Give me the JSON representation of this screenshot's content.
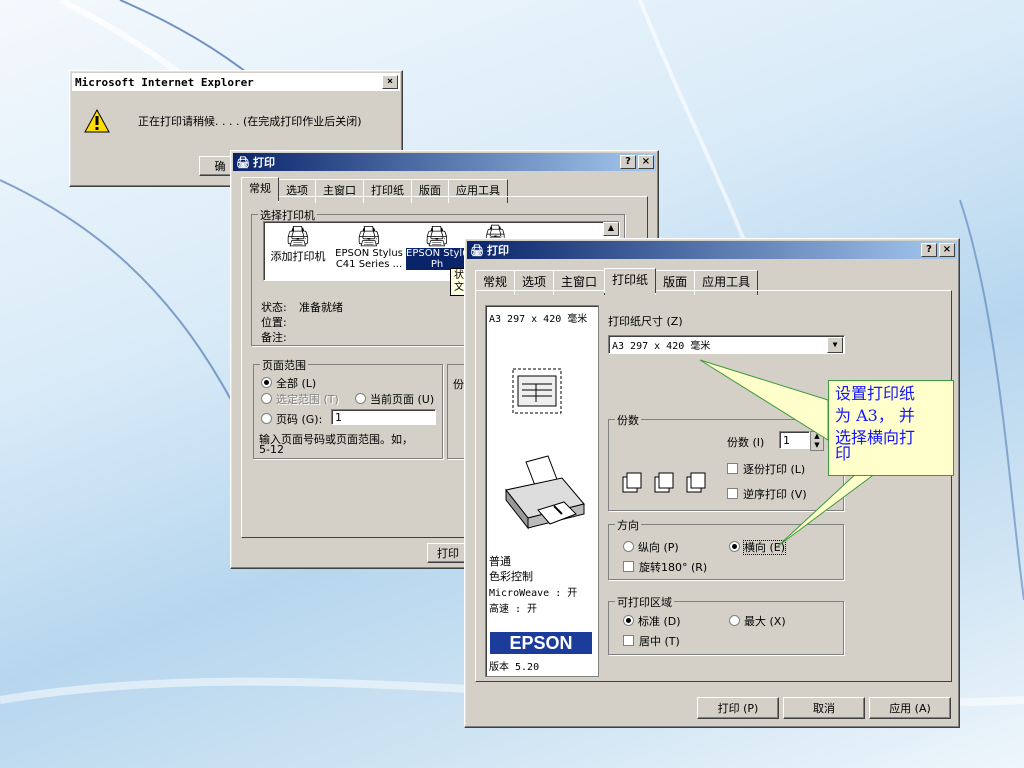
{
  "ie_dialog": {
    "title": "Microsoft Internet Explorer",
    "message": "正在打印请稍候. . . . (在完成打印作业后关闭)",
    "button_partial": "确"
  },
  "back_print": {
    "title": "打印",
    "tabs": [
      "常规",
      "选项",
      "主窗口",
      "打印纸",
      "版面",
      "应用工具"
    ],
    "select_printer_label": "选择打印机",
    "printers": [
      {
        "name1": "添加打印机",
        "name2": ""
      },
      {
        "name1": "EPSON Stylus",
        "name2": "C41 Series ..."
      },
      {
        "name1": "EPSON Stylus",
        "name2": "Ph"
      },
      {
        "name1": "",
        "name2": ""
      }
    ],
    "tooltip_status": "状态: 1",
    "tooltip_doc": "文档: (",
    "status_label": "状态:",
    "status_value": "准备就绪",
    "location_label": "位置:",
    "comment_label": "备注:",
    "page_range_label": "页面范围",
    "all_label": "全部 (L)",
    "selection_label": "选定范围 (T)",
    "current_page_label": "当前页面 (U)",
    "pages_label": "页码 (G):",
    "pages_value": "1",
    "hint": "输入页面号码或页面范围。如，",
    "hint2": "5-12",
    "copies_partial": "份",
    "print_btn_partial": "打印"
  },
  "front_print": {
    "title": "打印",
    "tabs": [
      "常规",
      "选项",
      "主窗口",
      "打印纸",
      "版面",
      "应用工具"
    ],
    "preview": {
      "paper_text": "A3 297 x 420 毫米",
      "mode1": "普通",
      "mode2": "色彩控制",
      "mode3": "MicroWeave : 开",
      "mode4": "高速 : 开",
      "brand": "EPSON",
      "version": "版本 5.20"
    },
    "paper_size_label": "打印纸尺寸 (Z)",
    "paper_size_value": "A3 297 x 420 毫米",
    "copies_group": "份数",
    "copies_label": "份数 (I)",
    "copies_value": "1",
    "collate_label": "逐份打印 (L)",
    "reverse_label": "逆序打印 (V)",
    "orientation_group": "方向",
    "portrait_label": "纵向 (P)",
    "landscape_label": "横向 (E)",
    "rotate_label": "旋转180° (R)",
    "area_group": "可打印区域",
    "standard_label": "标准 (D)",
    "max_label": "最大 (X)",
    "center_label": "居中 (T)",
    "print_button": "打印 (P)",
    "cancel_button": "取消",
    "apply_button": "应用 (A)"
  },
  "callout": {
    "line1": "设置打印纸",
    "line2": "为 A3， 并",
    "line3": "选择横向打",
    "line4": "印"
  }
}
